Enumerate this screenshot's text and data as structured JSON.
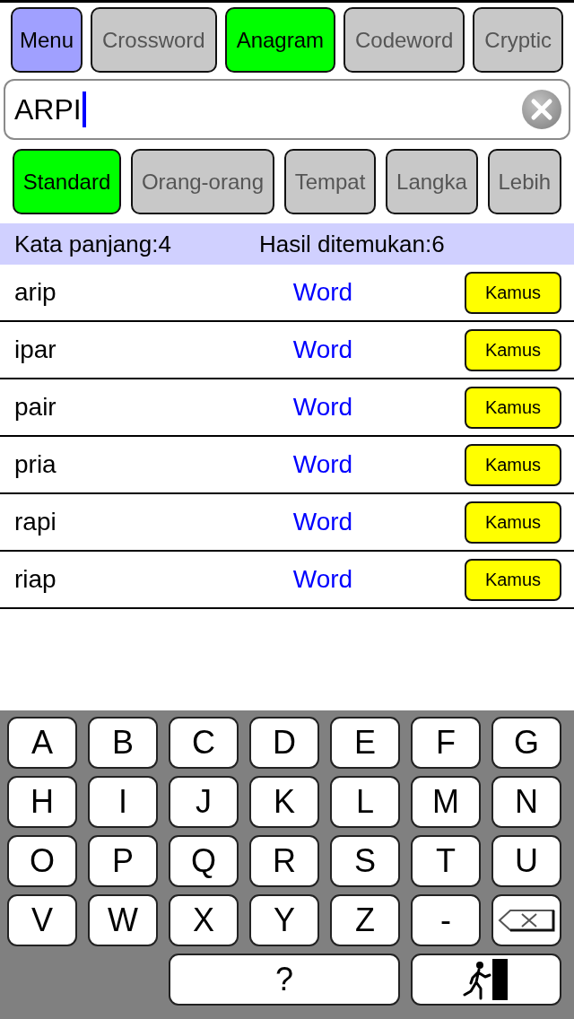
{
  "top_bar": {
    "menu_button": {
      "label": "Menu"
    },
    "tabs": [
      {
        "label": "Crossword",
        "selected": false
      },
      {
        "label": "Anagram",
        "selected": true
      },
      {
        "label": "Codeword",
        "selected": false
      },
      {
        "label": "Cryptic",
        "selected": false
      }
    ]
  },
  "search": {
    "value": "ARPI",
    "focused": true
  },
  "filters": [
    {
      "label": "Standard",
      "selected": true
    },
    {
      "label": "Orang-orang",
      "selected": false
    },
    {
      "label": "Tempat",
      "selected": false
    },
    {
      "label": "Langka",
      "selected": false
    },
    {
      "label": "Lebih",
      "selected": false
    }
  ],
  "summary": {
    "word_length": "Kata panjang:4",
    "results_found": "Hasil ditemukan:6"
  },
  "results": [
    {
      "word": "arip",
      "link": "Word",
      "button": "Kamus"
    },
    {
      "word": "ipar",
      "link": "Word",
      "button": "Kamus"
    },
    {
      "word": "pair",
      "link": "Word",
      "button": "Kamus"
    },
    {
      "word": "pria",
      "link": "Word",
      "button": "Kamus"
    },
    {
      "word": "rapi",
      "link": "Word",
      "button": "Kamus"
    },
    {
      "word": "riap",
      "link": "Word",
      "button": "Kamus"
    }
  ],
  "keyboard": {
    "rows": [
      [
        {
          "kind": "char",
          "label": "A"
        },
        {
          "kind": "char",
          "label": "B"
        },
        {
          "kind": "char",
          "label": "C"
        },
        {
          "kind": "char",
          "label": "D"
        },
        {
          "kind": "char",
          "label": "E"
        },
        {
          "kind": "char",
          "label": "F"
        },
        {
          "kind": "char",
          "label": "G"
        }
      ],
      [
        {
          "kind": "char",
          "label": "H"
        },
        {
          "kind": "char",
          "label": "I"
        },
        {
          "kind": "char",
          "label": "J"
        },
        {
          "kind": "char",
          "label": "K"
        },
        {
          "kind": "char",
          "label": "L"
        },
        {
          "kind": "char",
          "label": "M"
        },
        {
          "kind": "char",
          "label": "N"
        }
      ],
      [
        {
          "kind": "char",
          "label": "O"
        },
        {
          "kind": "char",
          "label": "P"
        },
        {
          "kind": "char",
          "label": "Q"
        },
        {
          "kind": "char",
          "label": "R"
        },
        {
          "kind": "char",
          "label": "S"
        },
        {
          "kind": "char",
          "label": "T"
        },
        {
          "kind": "char",
          "label": "U"
        }
      ],
      [
        {
          "kind": "char",
          "label": "V"
        },
        {
          "kind": "char",
          "label": "W"
        },
        {
          "kind": "char",
          "label": "X"
        },
        {
          "kind": "char",
          "label": "Y"
        },
        {
          "kind": "char",
          "label": "Z"
        },
        {
          "kind": "char",
          "label": "-"
        },
        {
          "kind": "backspace"
        }
      ]
    ],
    "action_keys": [
      {
        "kind": "char",
        "label": "?"
      },
      {
        "kind": "exit"
      }
    ]
  }
}
